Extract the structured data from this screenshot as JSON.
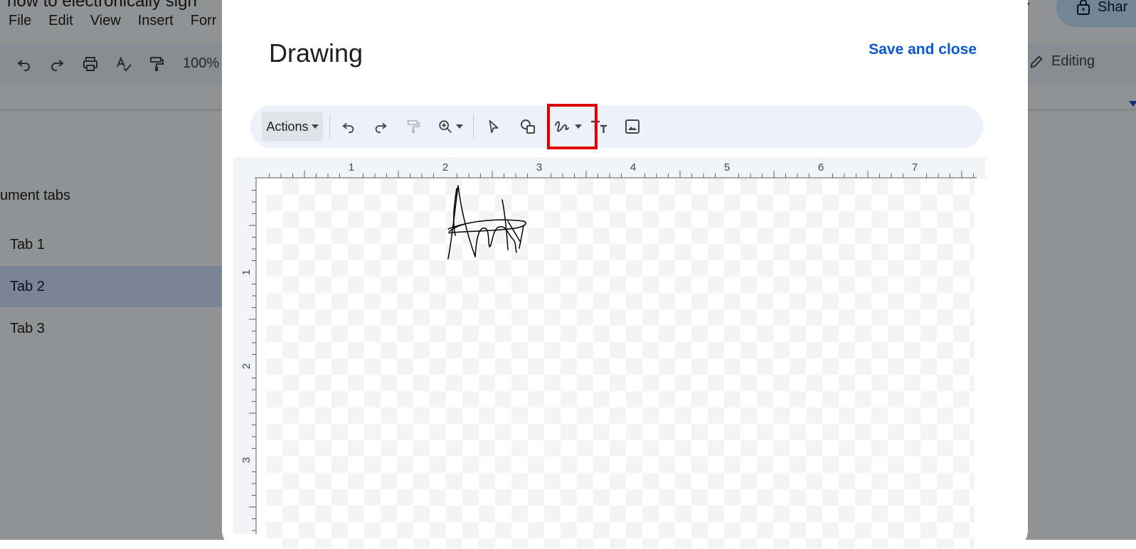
{
  "doc": {
    "title": "how to electronically sign",
    "menu": [
      "File",
      "Edit",
      "View",
      "Insert",
      "Forr"
    ],
    "zoom": "100%",
    "tabs_heading": "ument tabs",
    "tabs": [
      {
        "label": "Tab 1",
        "active": false
      },
      {
        "label": "Tab 2",
        "active": true
      },
      {
        "label": "Tab 3",
        "active": false
      }
    ],
    "share_label": "Shar",
    "editing_label": "Editing"
  },
  "dialog": {
    "title": "Drawing",
    "save_close": "Save and close",
    "toolbar": {
      "actions_label": "Actions",
      "icons": [
        "undo-icon",
        "redo-icon",
        "paint-format-icon",
        "zoom-icon",
        "select-icon",
        "shape-icon",
        "scribble-line-icon",
        "text-box-icon",
        "image-icon"
      ]
    },
    "ruler_top": [
      "1",
      "2",
      "3",
      "4",
      "5",
      "6",
      "7"
    ],
    "ruler_left": [
      "1",
      "2",
      "3"
    ]
  },
  "colors": {
    "accent": "#0b57d0",
    "highlight": "#e00000",
    "overlay": "rgba(0,0,0,0.42)"
  }
}
